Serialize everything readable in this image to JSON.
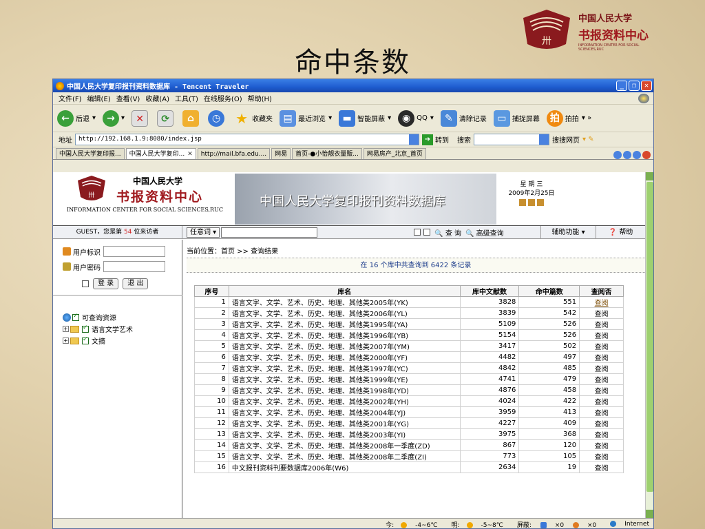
{
  "slide": {
    "title": "命中条数",
    "logo_line1": "中国人民大学",
    "logo_line2": "书报资料中心",
    "logo_line3": "INFORMATION CENTER FOR SOCIAL SCIENCES,RUC"
  },
  "browser": {
    "title": "中国人民大学复印报刊资料数据库 - Tencent Traveler",
    "menu": [
      "文件(F)",
      "编辑(E)",
      "查看(V)",
      "收藏(A)",
      "工具(T)",
      "在线服务(O)",
      "帮助(H)"
    ],
    "toolbar": {
      "back": "后退",
      "favorites": "收藏夹",
      "recent": "最近浏览",
      "smart_block": "智能屏蔽",
      "qq": "QQ",
      "clear": "清除记录",
      "capture": "捕捉屏幕",
      "snapshot": "拍拍"
    },
    "address_label": "地址",
    "address_url": "http://192.168.1.9:8080/index.jsp",
    "go_label": "转到",
    "search_label": "搜索",
    "sogou_label": "搜搜网页",
    "tabs": [
      "中国人民大学复印报...",
      "中国人民大学复印...",
      "http://mail.bfa.edu....",
      "网易",
      "首页-●小怡靓衣量贩...",
      "网易房产_北京_首页"
    ],
    "status": {
      "today": "今:",
      "today_temp": "-4~6℃",
      "tomorrow": "明:",
      "tomorrow_temp": "-5~8℃",
      "block": "屏蔽:",
      "block_count1": "×0",
      "block_count2": "×0",
      "zone": "Internet"
    }
  },
  "site": {
    "logo_name": "中国人民大学",
    "logo_center": "书报资料中心",
    "logo_en": "INFORMATION CENTER FOR SOCIAL SCIENCES,RUC",
    "banner": "中国人民大学复印报刊资料数据库",
    "weekday": "星 期 三",
    "date": "2009年2月25日"
  },
  "nav": {
    "guest_prefix": "GUEST，您是第",
    "guest_number": "54",
    "guest_suffix": "位来访者",
    "any_keyword": "任意词",
    "search": "查 询",
    "advanced": "高级查询",
    "assist": "辅助功能",
    "help": "帮助"
  },
  "sidebar": {
    "user_id_label": "用户标识",
    "password_label": "用户密码",
    "login": "登 录",
    "logout": "退 出",
    "tree_root": "可查询资源",
    "tree_items": [
      "语言文学艺术",
      "文摘"
    ]
  },
  "main": {
    "breadcrumb": "当前位置：首页 >> 查询结果",
    "summary": "在 16 个库中共查询到 6422 条记录",
    "columns": [
      "序号",
      "库名",
      "库中文献数",
      "命中篇数",
      "查阅否"
    ],
    "rows": [
      {
        "no": "1",
        "name": "语言文字、文学、艺术、历史、地理、其他类2005年(YK)",
        "total": "3828",
        "hits": "551",
        "action": "查阅"
      },
      {
        "no": "2",
        "name": "语言文字、文学、艺术、历史、地理、其他类2006年(YL)",
        "total": "3839",
        "hits": "542",
        "action": "查阅"
      },
      {
        "no": "3",
        "name": "语言文字、文学、艺术、历史、地理、其他类1995年(YA)",
        "total": "5109",
        "hits": "526",
        "action": "查阅"
      },
      {
        "no": "4",
        "name": "语言文字、文学、艺术、历史、地理、其他类1996年(YB)",
        "total": "5154",
        "hits": "526",
        "action": "查阅"
      },
      {
        "no": "5",
        "name": "语言文字、文学、艺术、历史、地理、其他类2007年(YM)",
        "total": "3417",
        "hits": "502",
        "action": "查阅"
      },
      {
        "no": "6",
        "name": "语言文字、文学、艺术、历史、地理、其他类2000年(YF)",
        "total": "4482",
        "hits": "497",
        "action": "查阅"
      },
      {
        "no": "7",
        "name": "语言文字、文学、艺术、历史、地理、其他类1997年(YC)",
        "total": "4842",
        "hits": "485",
        "action": "查阅"
      },
      {
        "no": "8",
        "name": "语言文字、文学、艺术、历史、地理、其他类1999年(YE)",
        "total": "4741",
        "hits": "479",
        "action": "查阅"
      },
      {
        "no": "9",
        "name": "语言文字、文学、艺术、历史、地理、其他类1998年(YD)",
        "total": "4876",
        "hits": "458",
        "action": "查阅"
      },
      {
        "no": "10",
        "name": "语言文字、文学、艺术、历史、地理、其他类2002年(YH)",
        "total": "4024",
        "hits": "422",
        "action": "查阅"
      },
      {
        "no": "11",
        "name": "语言文字、文学、艺术、历史、地理、其他类2004年(YJ)",
        "total": "3959",
        "hits": "413",
        "action": "查阅"
      },
      {
        "no": "12",
        "name": "语言文字、文学、艺术、历史、地理、其他类2001年(YG)",
        "total": "4227",
        "hits": "409",
        "action": "查阅"
      },
      {
        "no": "13",
        "name": "语言文字、文学、艺术、历史、地理、其他类2003年(YI)",
        "total": "3975",
        "hits": "368",
        "action": "查阅"
      },
      {
        "no": "14",
        "name": "语言文字、文学、艺术、历史、地理、其他类2008年一季度(ZD)",
        "total": "867",
        "hits": "120",
        "action": "查阅"
      },
      {
        "no": "15",
        "name": "语言文字、文学、艺术、历史、地理、其他类2008年二季度(ZI)",
        "total": "773",
        "hits": "105",
        "action": "查阅"
      },
      {
        "no": "16",
        "name": "中文报刊资料刊要数据库2006年(W6)",
        "total": "2634",
        "hits": "19",
        "action": "查阅"
      }
    ]
  }
}
